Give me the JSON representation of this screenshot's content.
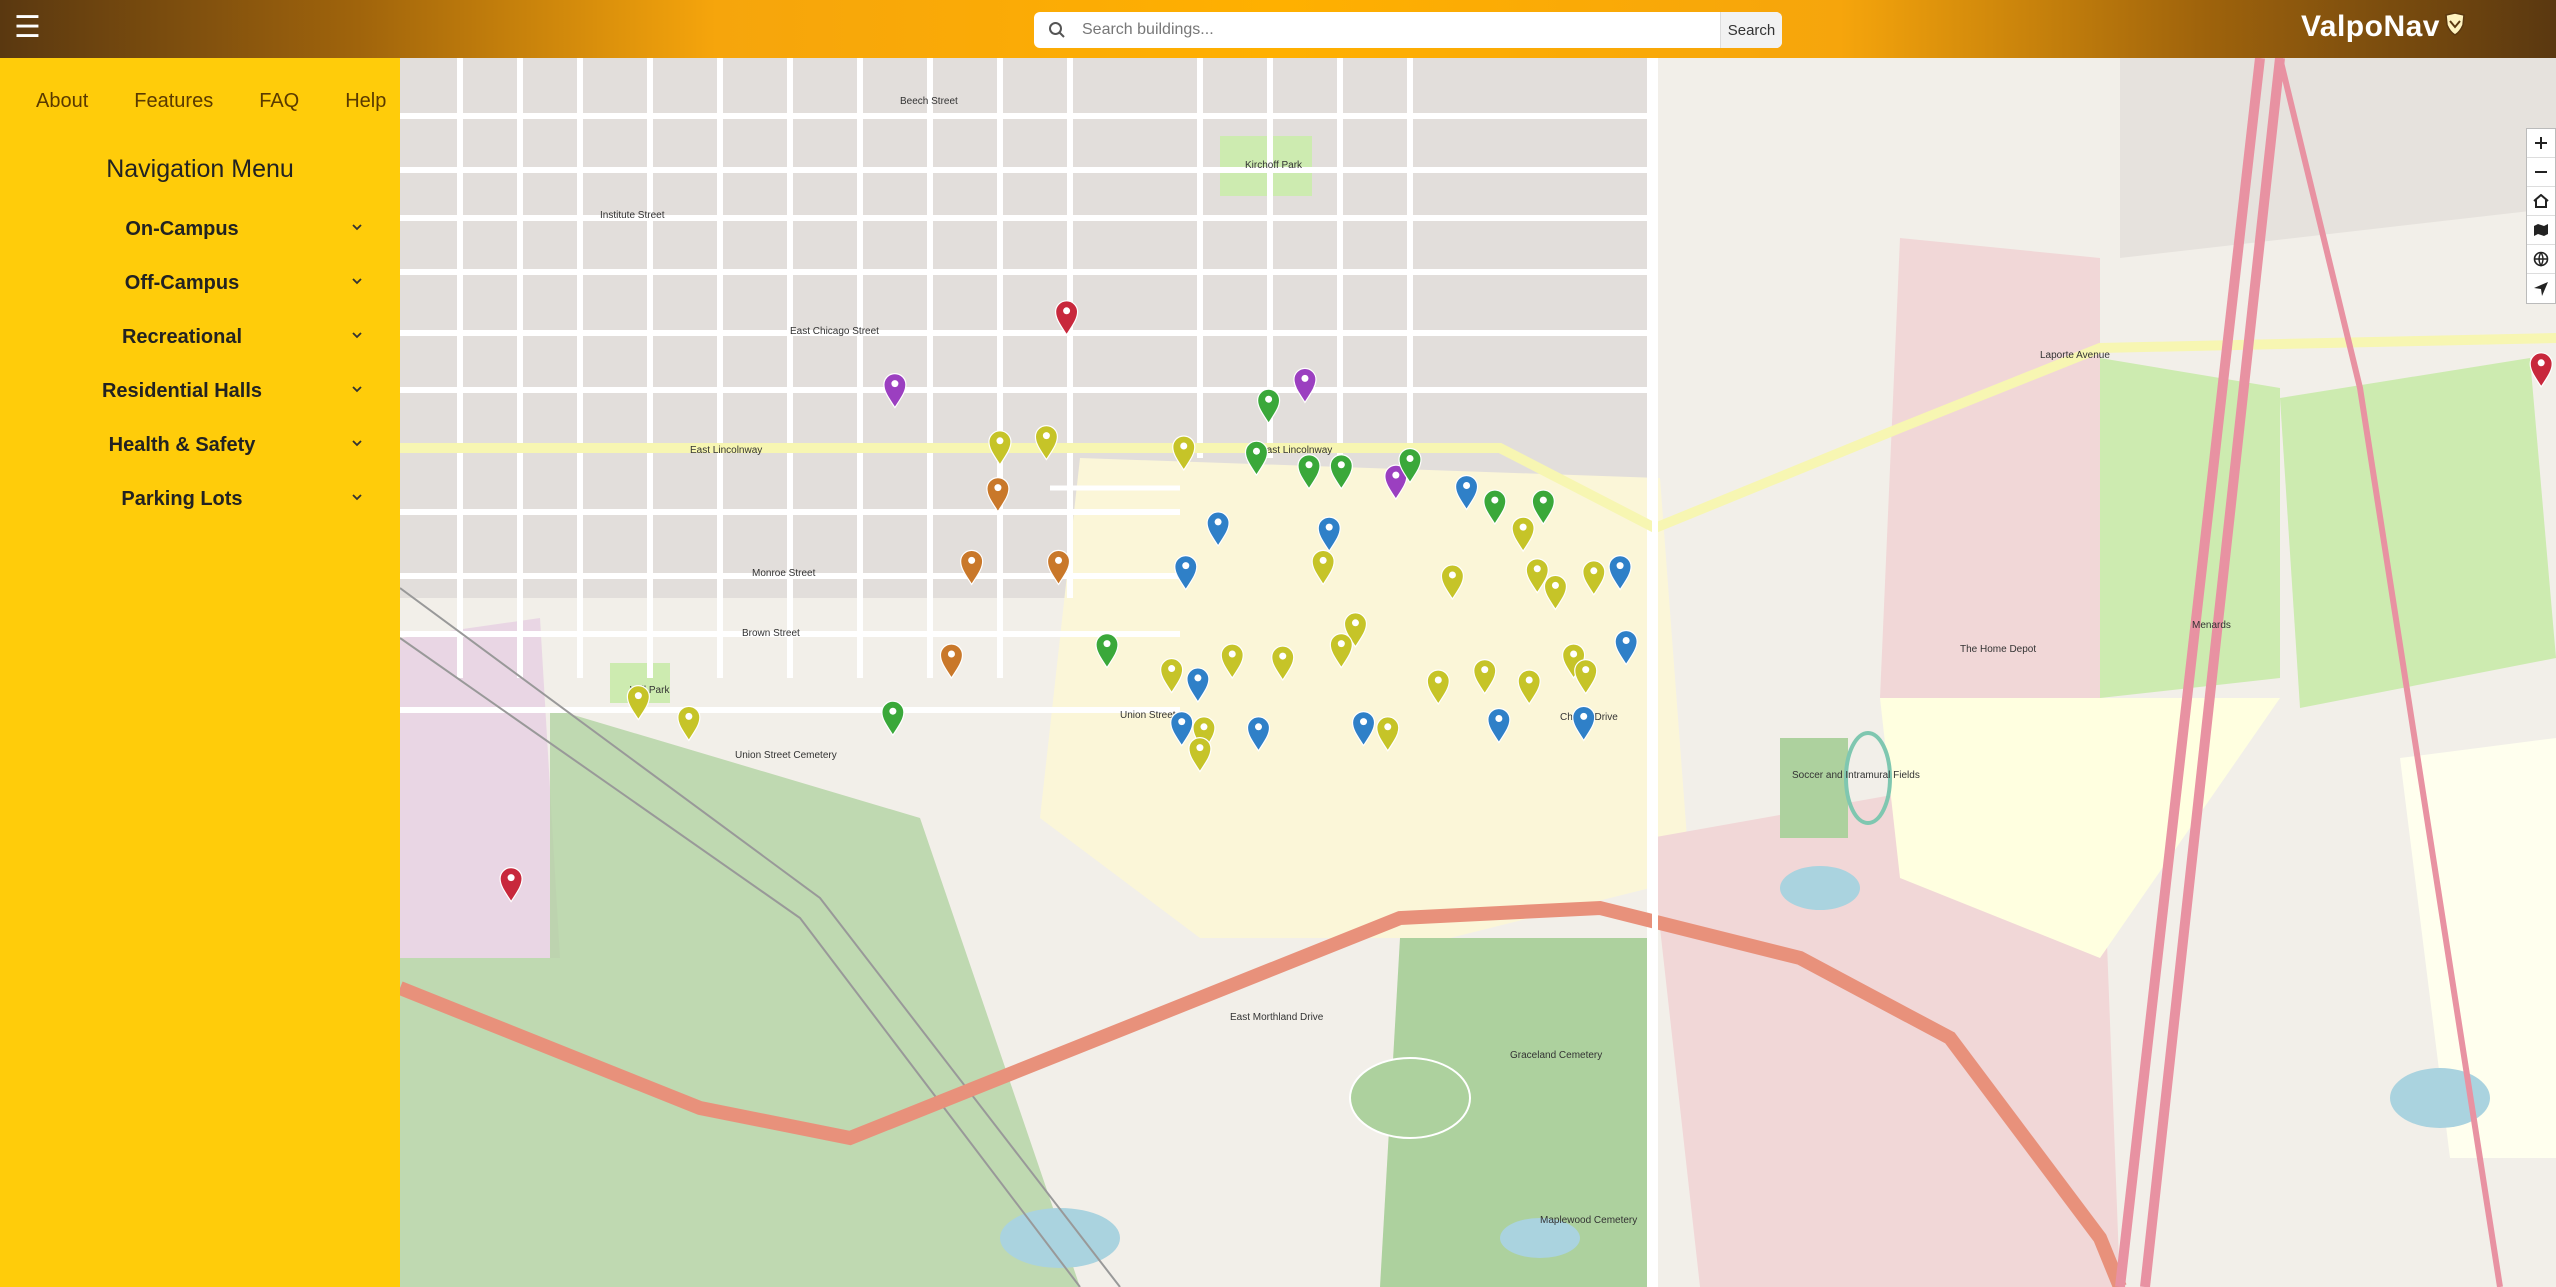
{
  "header": {
    "menu_icon": "hamburger-icon",
    "search_placeholder": "Search buildings...",
    "search_button": "Search",
    "brand": "ValpoNav",
    "brand_icon": "shield-icon"
  },
  "sidebar": {
    "top_links": [
      "About",
      "Features",
      "FAQ",
      "Help"
    ],
    "title": "Navigation Menu",
    "menu": [
      {
        "label": "On-Campus"
      },
      {
        "label": "Off-Campus"
      },
      {
        "label": "Recreational"
      },
      {
        "label": "Residential Halls"
      },
      {
        "label": "Health & Safety"
      },
      {
        "label": "Parking Lots"
      }
    ]
  },
  "map": {
    "controls": [
      "zoom-in-icon",
      "zoom-out-icon",
      "home-icon",
      "map-layers-icon",
      "globe-icon",
      "locate-icon"
    ],
    "labels": {
      "lincolnway": "East Lincolnway",
      "laporte": "Laporte Avenue",
      "chapel": "Chapel Drive",
      "northland": "East Morthland Drive",
      "union": "Union Street",
      "cemetery": "Graceland Cemetery",
      "home_depot": "The Home Depot",
      "menards": "Menards",
      "chicago": "East Chicago Street",
      "institute": "Institute Street",
      "brown": "Brown Street",
      "monroe": "Monroe Street",
      "beech": "Beech Street",
      "soccer": "Soccer and Intramural Fields",
      "maplewood": "Maplewood Cemetery",
      "union_cem": "Union Street Cemetery",
      "will_park": "Will Park",
      "kirchoff": "Kirchoff Park"
    },
    "colors": {
      "red": "#c8283c",
      "purple": "#9b3fc0",
      "green": "#3aa83a",
      "yellow": "#c6c428",
      "orange": "#c9782a",
      "blue": "#2f80c8"
    }
  }
}
